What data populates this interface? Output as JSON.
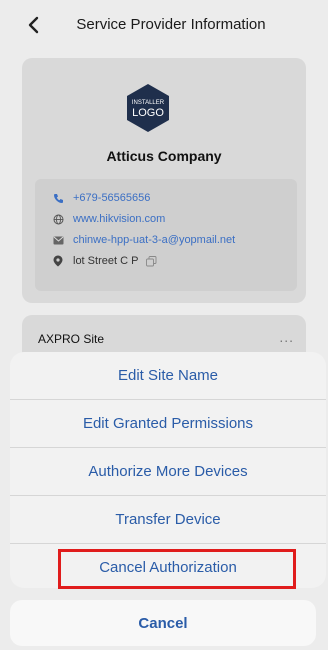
{
  "header": {
    "title": "Service Provider Information",
    "back_icon": "chevron-left-icon"
  },
  "provider": {
    "logo_line1": "INSTALLER",
    "logo_line2": "LOGO",
    "company": "Atticus Company",
    "phone": "+679-56565656",
    "website": "www.hikvision.com",
    "email": "chinwe-hpp-uat-3-a@yopmail.net",
    "address": "lot Street C P"
  },
  "site": {
    "name": "AXPRO Site",
    "more": "..."
  },
  "action_sheet": {
    "items": [
      {
        "label": "Edit Site Name"
      },
      {
        "label": "Edit Granted Permissions"
      },
      {
        "label": "Authorize More Devices"
      },
      {
        "label": "Transfer Device"
      },
      {
        "label": "Cancel Authorization"
      }
    ],
    "cancel_label": "Cancel"
  },
  "colors": {
    "accent": "#2a5ca8",
    "link": "#3b6fc4",
    "highlight": "#e01c1c",
    "logo": "#1f2f4c"
  }
}
